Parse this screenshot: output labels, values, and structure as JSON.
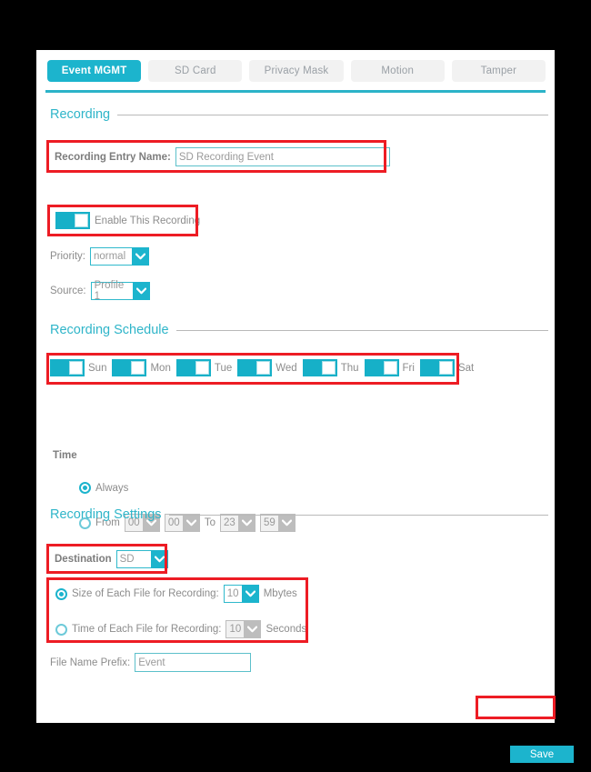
{
  "theme": {
    "accent": "#1cb4cd",
    "accent_light": "#2fb5c9",
    "annotation": "#ed1c24",
    "label": "#8c8c8c",
    "page_background": "#000000",
    "panel_background": "#ffffff"
  },
  "tabs": [
    {
      "label": "Event MGMT",
      "active": true
    },
    {
      "label": "SD Card",
      "active": false
    },
    {
      "label": "Privacy Mask",
      "active": false
    },
    {
      "label": "Motion",
      "active": false
    },
    {
      "label": "Tamper",
      "active": false
    }
  ],
  "sections": {
    "recording": {
      "title": "Recording",
      "entry_name_label": "Recording Entry Name:",
      "entry_name_value": "SD Recording Event",
      "enable_label": "Enable This Recording",
      "enable_state": "on",
      "priority_label": "Priority:",
      "priority_value": "normal",
      "source_label": "Source:",
      "source_value": "Profile 1"
    },
    "schedule": {
      "title": "Recording Schedule",
      "days": [
        {
          "label": "Sun",
          "state": "on"
        },
        {
          "label": "Mon",
          "state": "on"
        },
        {
          "label": "Tue",
          "state": "on"
        },
        {
          "label": "Wed",
          "state": "on"
        },
        {
          "label": "Thu",
          "state": "on"
        },
        {
          "label": "Fri",
          "state": "on"
        },
        {
          "label": "Sat",
          "state": "on"
        }
      ],
      "time_label": "Time",
      "always_label": "Always",
      "always_selected": true,
      "from_label": "From",
      "to_label": "To",
      "from_hour": "00",
      "from_minute": "00",
      "to_hour": "23",
      "to_minute": "59",
      "range_selected": false
    },
    "settings": {
      "title": "Recording Settings",
      "destination_label": "Destination",
      "destination_value": "SD",
      "size_label": "Size of Each File for Recording:",
      "size_value": "10",
      "size_unit": "Mbytes",
      "size_selected": true,
      "time_label": "Time of Each File for Recording:",
      "time_value": "10",
      "time_unit": "Seconds",
      "time_selected": false,
      "prefix_label": "File Name Prefix:",
      "prefix_value": "Event"
    }
  },
  "footer": {
    "save_label": "Save"
  }
}
